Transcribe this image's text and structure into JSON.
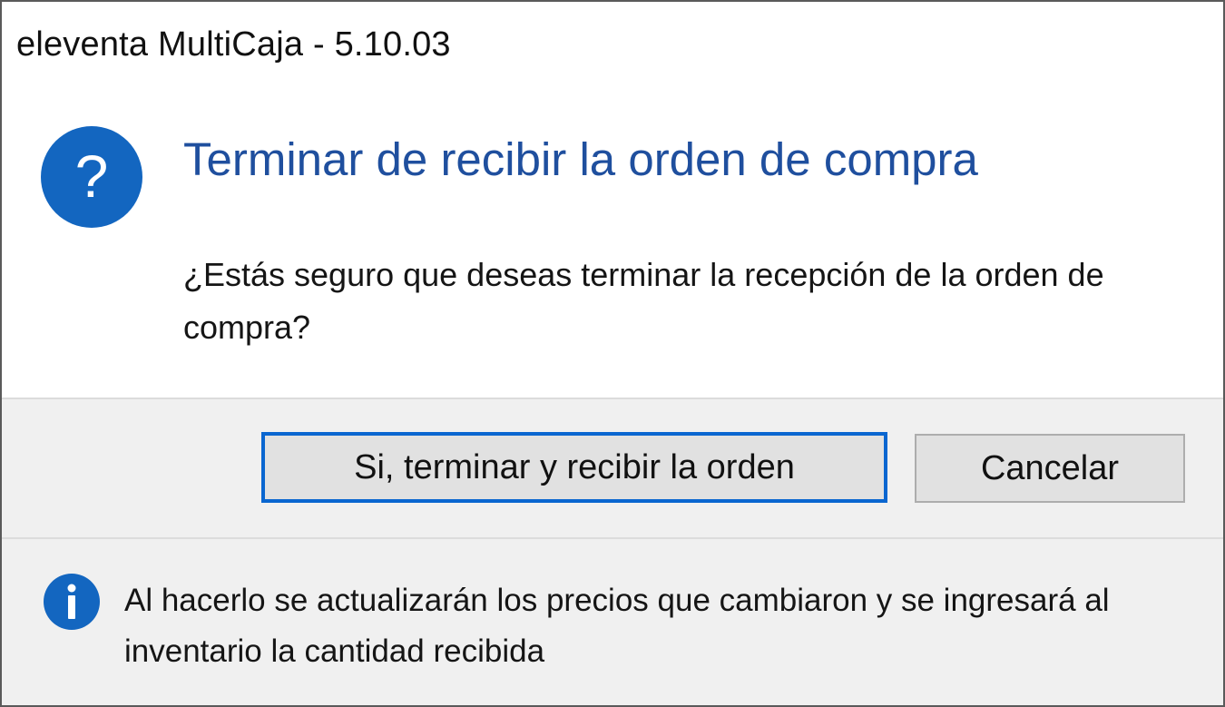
{
  "window": {
    "title": "eleventa MultiCaja - 5.10.03"
  },
  "dialog": {
    "icon": "question-icon",
    "main_instruction": "Terminar de recibir la orden de compra",
    "content": "¿Estás seguro que deseas terminar la recepción de la orden de compra?"
  },
  "buttons": {
    "confirm_label": "Si, terminar y recibir la orden",
    "cancel_label": "Cancelar"
  },
  "footer": {
    "icon": "info-icon",
    "text": "Al hacerlo se actualizarán los precios que cambiaron y se ingresará al inventario la cantidad recibida"
  },
  "colors": {
    "accent_blue": "#1366c0",
    "instruction_blue": "#1f4f9e",
    "default_button_border": "#0a66d0",
    "button_area_bg": "#f0f0f0"
  }
}
